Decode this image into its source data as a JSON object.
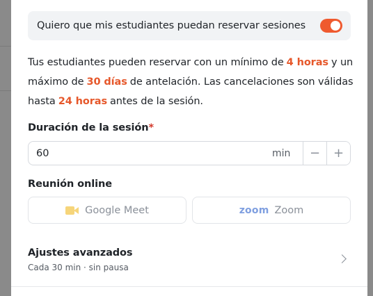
{
  "booking": {
    "toggle_label": "Quiero que mis estudiantes puedan reservar sesiones",
    "toggle_on": true,
    "accent_color": "#ef5a2f"
  },
  "policy": {
    "part1": "Tus estudiantes pueden reservar con un mínimo de",
    "min_notice": "4 horas",
    "part2": "y un máximo de",
    "max_advance": "30 días",
    "part3": "de antelación. Las cancelaciones son válidas hasta",
    "cancel_limit": "24 horas",
    "part4": "antes de la sesión."
  },
  "duration": {
    "label": "Duración de la sesión",
    "required_mark": "*",
    "value": "60",
    "unit": "min",
    "decrement": "−",
    "increment": "+"
  },
  "meeting": {
    "label": "Reunión online",
    "options": [
      {
        "name": "Google Meet",
        "icon": "google-meet-icon"
      },
      {
        "name": "Zoom",
        "logo_text": "zoom"
      }
    ]
  },
  "advanced": {
    "title": "Ajustes avanzados",
    "subtitle": "Cada 30 min · sin pausa"
  }
}
